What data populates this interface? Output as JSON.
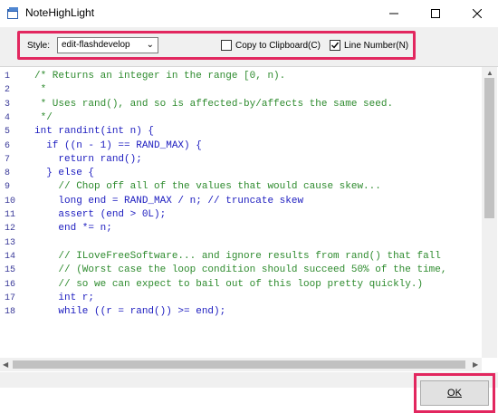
{
  "window": {
    "title": "NoteHighLight"
  },
  "toolbar": {
    "style_label": "Style:",
    "style_value": "edit-flashdevelop",
    "copy_label": "Copy to Clipboard(C)",
    "copy_checked": false,
    "line_number_label": "Line Number(N)",
    "line_number_checked": true
  },
  "editor": {
    "lines": [
      {
        "n": "1",
        "text": "/* Returns an integer in the range [0, n).",
        "kind": "comment"
      },
      {
        "n": "2",
        "text": " *",
        "kind": "comment"
      },
      {
        "n": "3",
        "text": " * Uses rand(), and so is affected-by/affects the same seed.",
        "kind": "comment"
      },
      {
        "n": "4",
        "text": " */",
        "kind": "comment"
      },
      {
        "n": "5",
        "text": "int randint(int n) {",
        "kind": "code"
      },
      {
        "n": "6",
        "text": "  if ((n - 1) == RAND_MAX) {",
        "kind": "code"
      },
      {
        "n": "7",
        "text": "    return rand();",
        "kind": "code"
      },
      {
        "n": "8",
        "text": "  } else {",
        "kind": "code"
      },
      {
        "n": "9",
        "text": "    // Chop off all of the values that would cause skew...",
        "kind": "comment"
      },
      {
        "n": "10",
        "text": "    long end = RAND_MAX / n; // truncate skew",
        "kind": "code"
      },
      {
        "n": "11",
        "text": "    assert (end > 0L);",
        "kind": "code"
      },
      {
        "n": "12",
        "text": "    end *= n;",
        "kind": "code"
      },
      {
        "n": "13",
        "text": "",
        "kind": "code"
      },
      {
        "n": "14",
        "text": "    // ILoveFreeSoftware... and ignore results from rand() that fall",
        "kind": "comment"
      },
      {
        "n": "15",
        "text": "    // (Worst case the loop condition should succeed 50% of the time,",
        "kind": "comment"
      },
      {
        "n": "16",
        "text": "    // so we can expect to bail out of this loop pretty quickly.)",
        "kind": "comment"
      },
      {
        "n": "17",
        "text": "    int r;",
        "kind": "code"
      },
      {
        "n": "18",
        "text": "    while ((r = rand()) >= end);",
        "kind": "code"
      }
    ]
  },
  "footer": {
    "ok_label": "OK"
  }
}
